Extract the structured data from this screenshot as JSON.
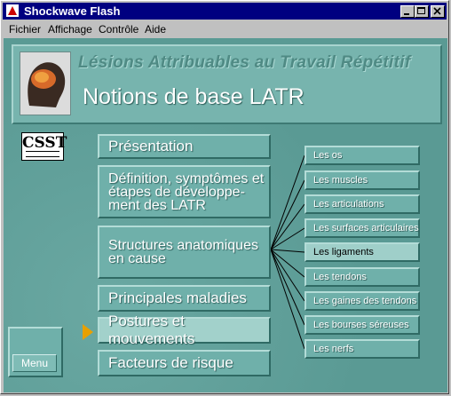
{
  "window": {
    "title": "Shockwave Flash"
  },
  "menubar": [
    "Fichier",
    "Affichage",
    "Contrôle",
    "Aide"
  ],
  "header": {
    "title": "Lésions Attribuables au Travail Répétitif",
    "subtitle": "Notions de base LATR"
  },
  "logo": {
    "text": "CSST"
  },
  "nav": [
    {
      "label": "Présentation"
    },
    {
      "label": "Définition, symptômes et étapes de développe- ment des LATR"
    },
    {
      "label": "Structures anatomiques en cause"
    },
    {
      "label": "Principales maladies"
    },
    {
      "label": "Postures et mouvements"
    },
    {
      "label": "Facteurs de risque"
    }
  ],
  "submenu": [
    "Les os",
    "Les muscles",
    "Les articulations",
    "Les surfaces articulaires",
    "Les ligaments",
    "Les tendons",
    "Les gaines des tendons",
    "Les bourses séreuses",
    "Les nerfs"
  ],
  "menu_button": "Menu",
  "colors": {
    "titlebar": "#000080",
    "teal": "#5e9e98",
    "arrow": "#e8a000"
  }
}
